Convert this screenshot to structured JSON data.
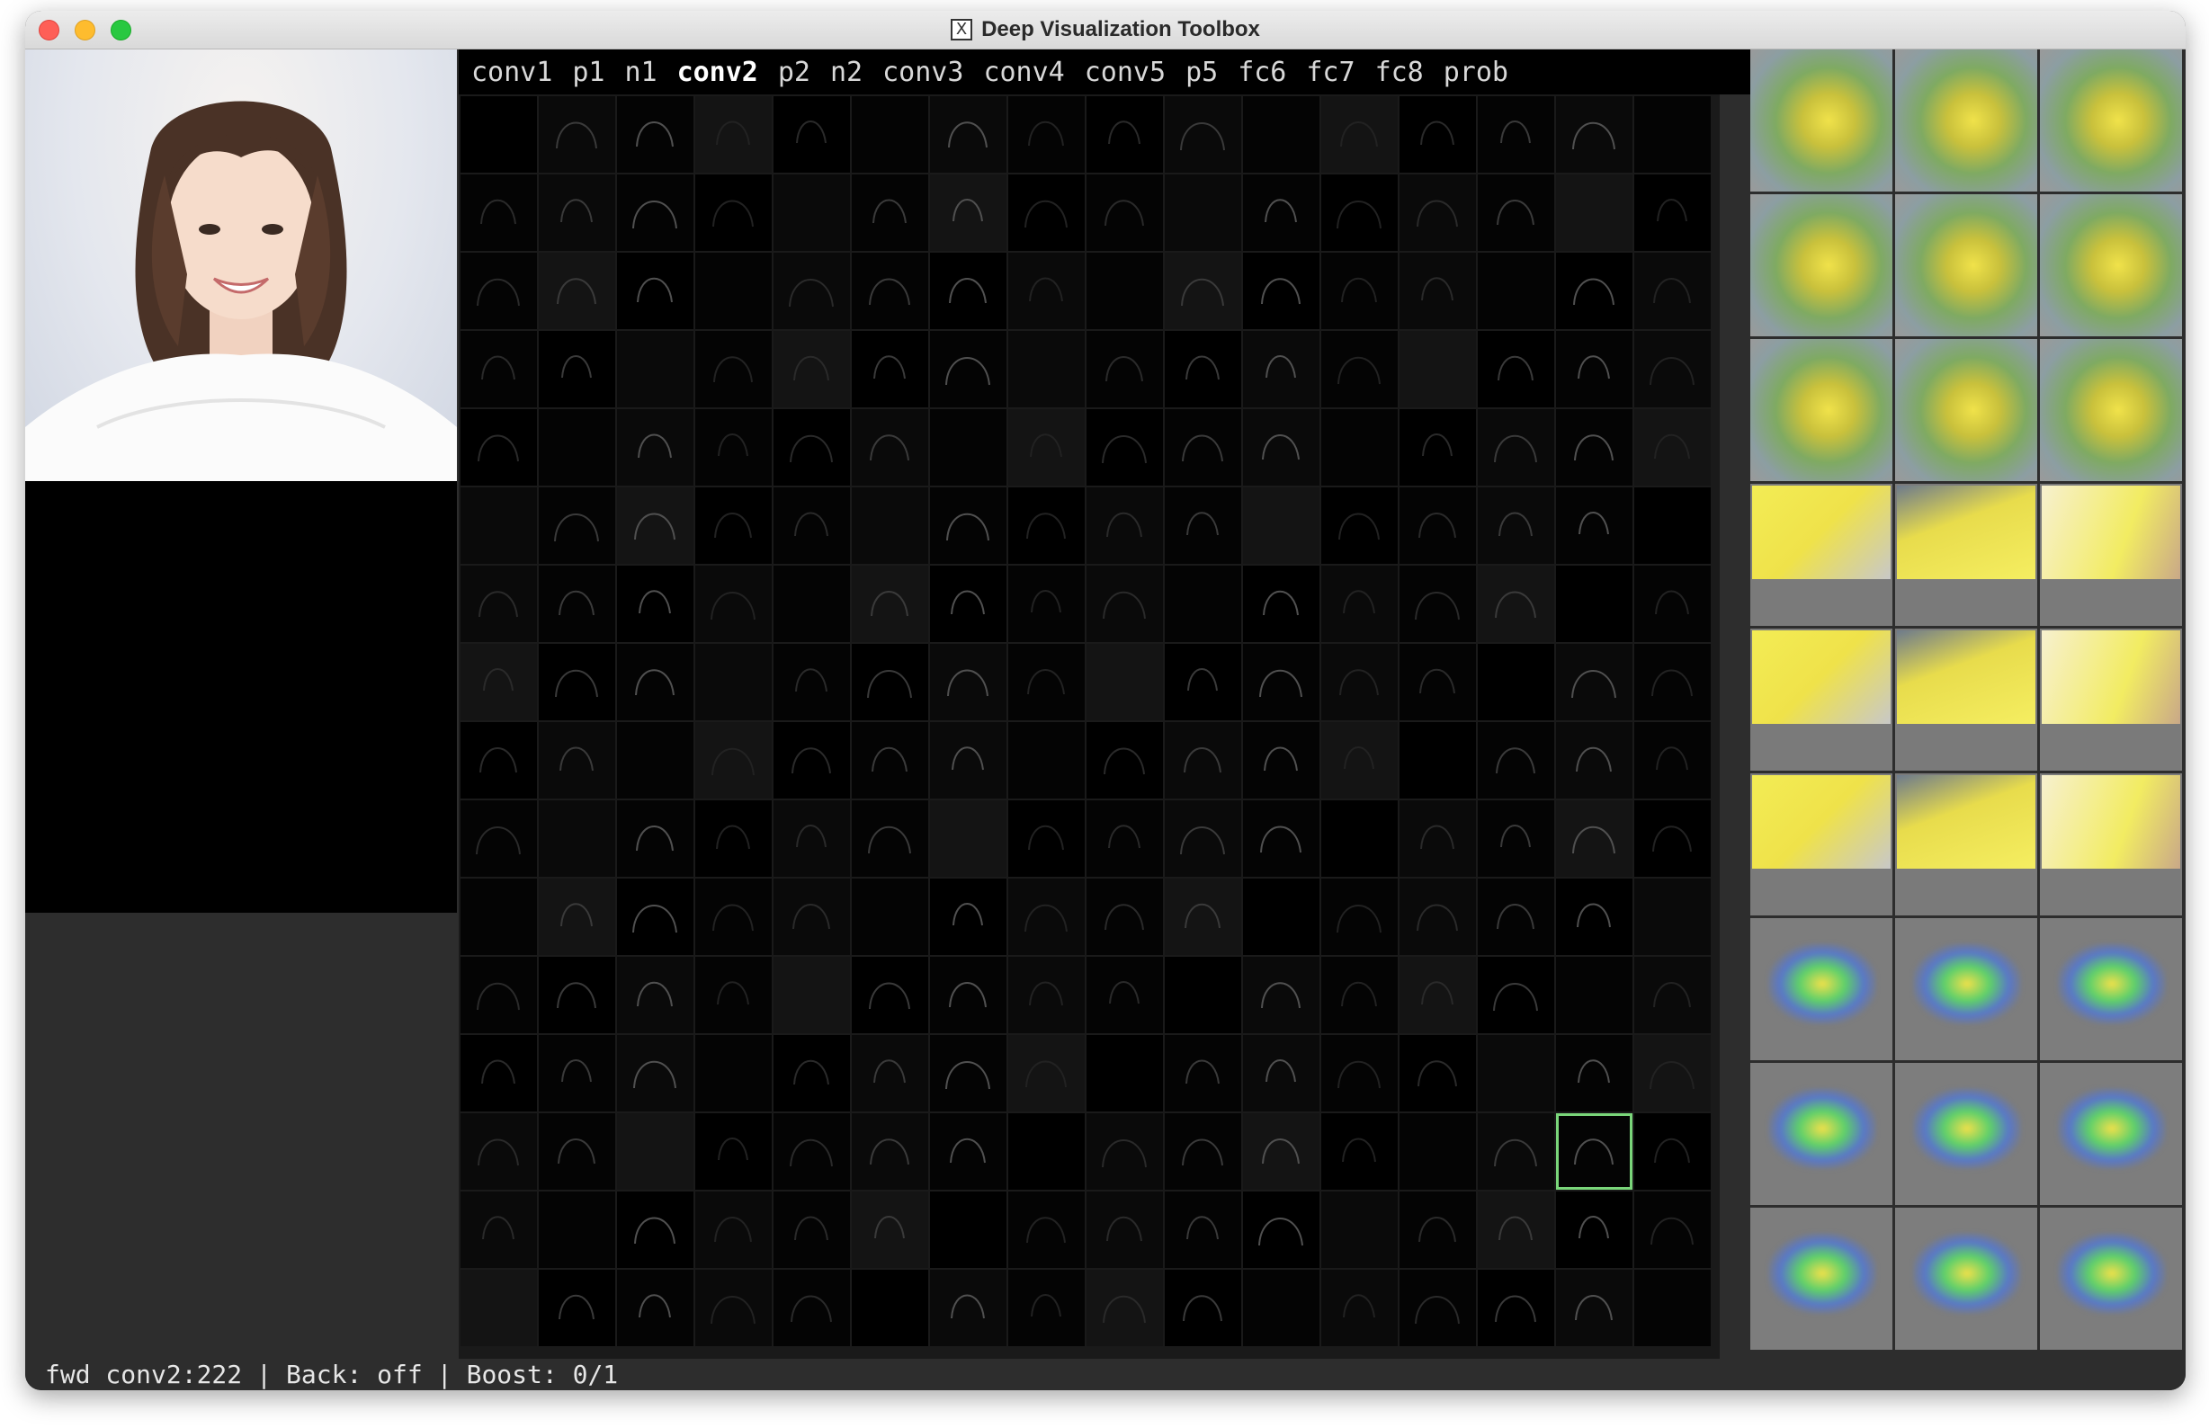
{
  "window": {
    "title": "Deep Visualization Toolbox",
    "app_icon": "x11-icon"
  },
  "layers": {
    "tabs": [
      {
        "label": "conv1",
        "active": false
      },
      {
        "label": "p1",
        "active": false
      },
      {
        "label": "n1",
        "active": false
      },
      {
        "label": "conv2",
        "active": true
      },
      {
        "label": "p2",
        "active": false
      },
      {
        "label": "n2",
        "active": false
      },
      {
        "label": "conv3",
        "active": false
      },
      {
        "label": "conv4",
        "active": false
      },
      {
        "label": "conv5",
        "active": false
      },
      {
        "label": "p5",
        "active": false
      },
      {
        "label": "fc6",
        "active": false
      },
      {
        "label": "fc7",
        "active": false
      },
      {
        "label": "fc8",
        "active": false
      },
      {
        "label": "prob",
        "active": false
      }
    ]
  },
  "activation_grid": {
    "rows": 16,
    "cols": 16,
    "selected_index": 222,
    "selected_color": "#7ad67a"
  },
  "status": {
    "mode": "fwd conv2:222",
    "back": "Back: off",
    "boost": "Boost: 0/1",
    "separator": "|"
  },
  "colors": {
    "window_bg": "#2d2d2d",
    "grid_bg": "#000000",
    "selection": "#7ad67a"
  }
}
